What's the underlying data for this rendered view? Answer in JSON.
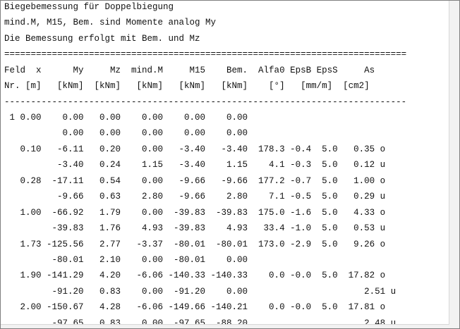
{
  "lines": [
    "Biegebemessung für Doppelbiegung",
    "mind.M, M15, Bem. sind Momente analog My",
    "Die Bemessung erfolgt mit Bem. und Mz",
    "============================================================================",
    "Feld  x      My     Mz  mind.M     M15    Bem.  Alfa0 EpsB EpsS     As",
    "Nr. [m]   [kNm]  [kNm]   [kNm]   [kNm]   [kNm]    [°]   [mm/m]  [cm2]",
    "----------------------------------------------------------------------------",
    " 1 0.00    0.00   0.00    0.00    0.00    0.00",
    "           0.00   0.00    0.00    0.00    0.00",
    "   0.10   -6.11   0.20    0.00   -3.40   -3.40  178.3 -0.4  5.0   0.35 o",
    "          -3.40   0.24    1.15   -3.40    1.15    4.1 -0.3  5.0   0.12 u",
    "   0.28  -17.11   0.54    0.00   -9.66   -9.66  177.2 -0.7  5.0   1.00 o",
    "          -9.66   0.63    2.80   -9.66    2.80    7.1 -0.5  5.0   0.29 u",
    "   1.00  -66.92   1.79    0.00  -39.83  -39.83  175.0 -1.6  5.0   4.33 o",
    "         -39.83   1.76    4.93  -39.83    4.93   33.4 -1.0  5.0   0.53 u",
    "   1.73 -125.56   2.77   -3.37  -80.01  -80.01  173.0 -2.9  5.0   9.26 o",
    "         -80.01   2.10    0.00  -80.01    0.00",
    "   1.90 -141.29   4.20   -6.06 -140.33 -140.33    0.0 -0.0  5.0  17.82 o",
    "         -91.20   0.83    0.00  -91.20    0.00                      2.51 u",
    "   2.00 -150.67   4.28   -6.06 -149.66 -140.21    0.0 -0.0  5.0  17.81 o",
    "         -97.65   0.83    0.00  -97.65  -88.20                      2.48 u"
  ]
}
